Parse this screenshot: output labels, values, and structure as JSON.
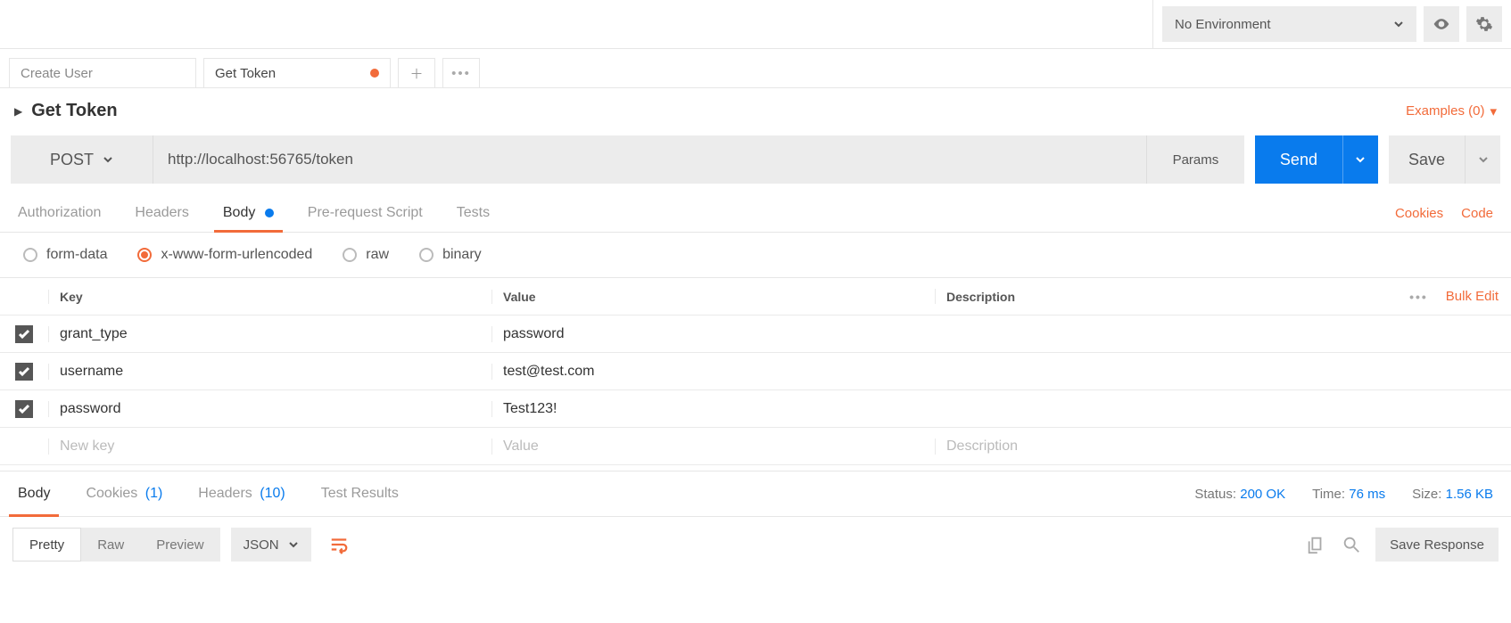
{
  "env": {
    "label": "No Environment"
  },
  "tabs": [
    {
      "label": "Create User",
      "dirty": false
    },
    {
      "label": "Get Token",
      "dirty": true
    }
  ],
  "request": {
    "title": "Get Token",
    "examples_label": "Examples (0)",
    "method": "POST",
    "url": "http://localhost:56765/token",
    "params_label": "Params",
    "send_label": "Send",
    "save_label": "Save",
    "subtabs": {
      "authorization": "Authorization",
      "headers": "Headers",
      "body": "Body",
      "prerequest": "Pre-request Script",
      "tests": "Tests"
    },
    "links": {
      "cookies": "Cookies",
      "code": "Code"
    },
    "body_types": {
      "form_data": "form-data",
      "urlencoded": "x-www-form-urlencoded",
      "raw": "raw",
      "binary": "binary"
    },
    "kv": {
      "headers": {
        "key": "Key",
        "value": "Value",
        "description": "Description"
      },
      "bulk_edit": "Bulk Edit",
      "rows": [
        {
          "key": "grant_type",
          "value": "password"
        },
        {
          "key": "username",
          "value": "test@test.com"
        },
        {
          "key": "password",
          "value": "Test123!"
        }
      ],
      "placeholders": {
        "key": "New key",
        "value": "Value",
        "description": "Description"
      }
    }
  },
  "response": {
    "tabs": {
      "body": "Body",
      "cookies": "Cookies",
      "cookies_count": "(1)",
      "headers": "Headers",
      "headers_count": "(10)",
      "test_results": "Test Results"
    },
    "meta": {
      "status_label": "Status:",
      "status_value": "200 OK",
      "time_label": "Time:",
      "time_value": "76 ms",
      "size_label": "Size:",
      "size_value": "1.56 KB"
    },
    "view": {
      "pretty": "Pretty",
      "raw": "Raw",
      "preview": "Preview",
      "format": "JSON"
    },
    "save_response": "Save Response"
  }
}
